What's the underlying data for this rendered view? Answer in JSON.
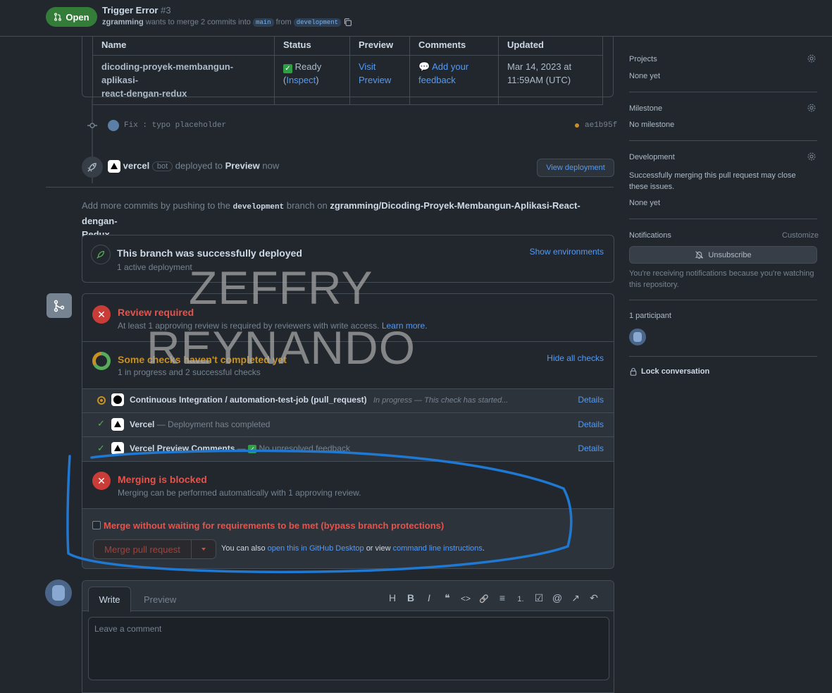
{
  "header": {
    "status_label": "Open",
    "title": "Trigger Error",
    "number": "#3",
    "author": "zgramming",
    "summary_mid": "wants to merge 2 commits into",
    "base_branch": "main",
    "from_word": "from",
    "head_branch": "development"
  },
  "deploy_table": {
    "headers": [
      "Name",
      "Status",
      "Preview",
      "Comments",
      "Updated"
    ],
    "name_line1": "dicoding-proyek-membangun-aplikasi-",
    "name_line2": "react-dengan-redux",
    "status": "Ready",
    "inspect": "Inspect",
    "preview_line1": "Visit",
    "preview_line2": "Preview",
    "comments_line1": "Add your",
    "comments_line2": "feedback",
    "updated_line1": "Mar 14, 2023 at",
    "updated_line2": "11:59AM (UTC)"
  },
  "commit": {
    "message": "Fix : typo placeholder",
    "sha": "ae1b95f"
  },
  "deploy_event": {
    "actor": "vercel",
    "bot_label": "bot",
    "text": "deployed to",
    "env": "Preview",
    "time": "now",
    "view_button": "View deployment"
  },
  "push_hint": {
    "prefix": "Add more commits by pushing to the",
    "branch": "development",
    "mid": "branch on",
    "repo_line1": "zgramming/Dicoding-Proyek-Membangun-Aplikasi-React-dengan-",
    "repo_line2": "Redux",
    "suffix": "."
  },
  "deployed_box": {
    "title": "This branch was successfully deployed",
    "subtitle": "1 active deployment",
    "link": "Show environments"
  },
  "merge_box": {
    "review_title": "Review required",
    "review_text": "At least 1 approving review is required by reviewers with write access.",
    "learn_more": "Learn more.",
    "checks_title": "Some checks haven't completed yet",
    "checks_subtitle": "1 in progress and 2 successful checks",
    "hide_checks": "Hide all checks",
    "checks": [
      {
        "name": "Continuous Integration / automation-test-job (pull_request)",
        "desc": "In progress — This check has started...",
        "details": "Details"
      },
      {
        "name": "Vercel",
        "desc": "— Deployment has completed",
        "details": "Details"
      },
      {
        "name": "Vercel Preview Comments",
        "desc": "— ",
        "desc2": "No unresolved feedback",
        "details": "Details"
      }
    ],
    "blocked_title": "Merging is blocked",
    "blocked_text": "Merging can be performed automatically with 1 approving review.",
    "bypass_label": "Merge without waiting for requirements to be met (bypass branch protections)",
    "merge_button": "Merge pull request",
    "also_prefix": "You can also",
    "desktop_link": "open this in GitHub Desktop",
    "or_view": "or view",
    "cli_link": "command line instructions",
    "also_suffix": "."
  },
  "comment_box": {
    "tab_write": "Write",
    "tab_preview": "Preview",
    "toolbar": [
      "H",
      "B",
      "I",
      "❝",
      "<>",
      "🔗",
      "≡",
      "1.",
      "☑",
      "@",
      "↗",
      "↶"
    ],
    "placeholder": "Leave a comment"
  },
  "sidebar": {
    "projects_label": "Projects",
    "projects_value": "None yet",
    "milestone_label": "Milestone",
    "milestone_value": "No milestone",
    "development_label": "Development",
    "development_text": "Successfully merging this pull request may close these issues.",
    "development_value": "None yet",
    "notifications_label": "Notifications",
    "customize": "Customize",
    "unsubscribe": "Unsubscribe",
    "notif_text": "You're receiving notifications because you're watching this repository.",
    "participants": "1 participant",
    "lock": "Lock conversation"
  },
  "watermark": {
    "line1": "ZEFFRY",
    "line2": "REYNANDO"
  },
  "colors": {
    "background": "#22272e",
    "border": "#444c56",
    "link": "#539bf5",
    "danger": "#e5534b",
    "success": "#347d39",
    "warning": "#c69026",
    "annotation": "#1f78d1"
  }
}
